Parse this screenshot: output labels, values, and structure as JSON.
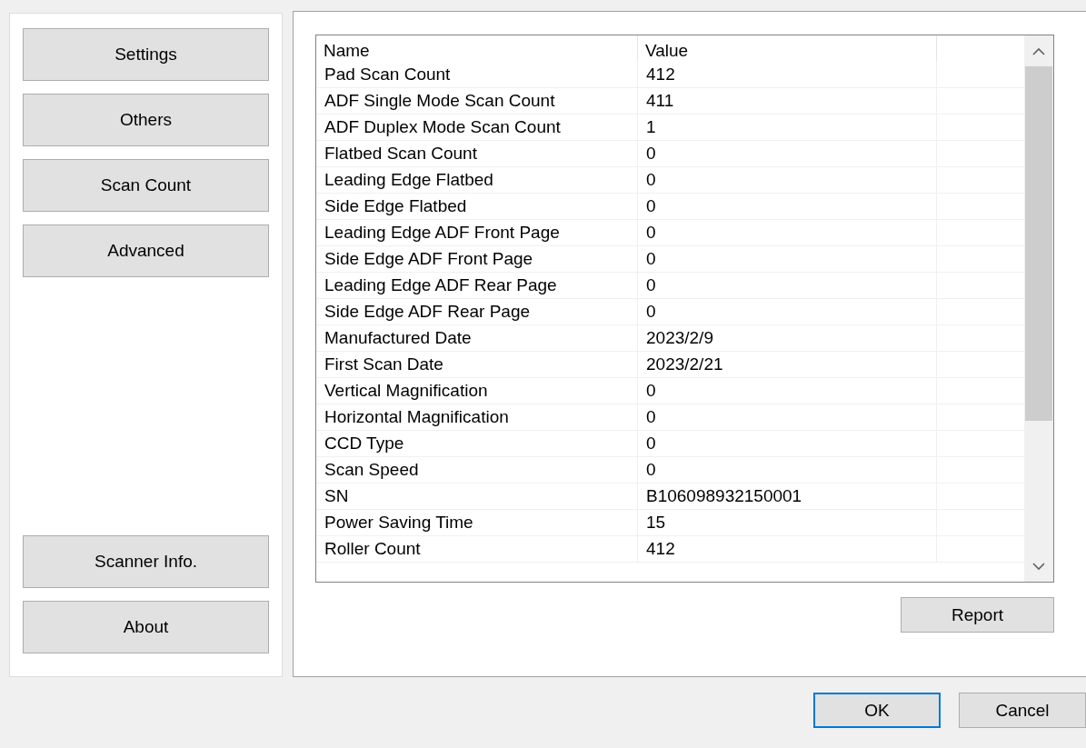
{
  "sidebar": {
    "top_buttons": [
      {
        "label": "Settings"
      },
      {
        "label": "Others"
      },
      {
        "label": "Scan Count"
      },
      {
        "label": "Advanced"
      }
    ],
    "bottom_buttons": [
      {
        "label": "Scanner Info."
      },
      {
        "label": "About"
      }
    ]
  },
  "table": {
    "columns": [
      "Name",
      "Value"
    ],
    "rows": [
      {
        "name": "Pad Scan Count",
        "value": "412"
      },
      {
        "name": "ADF Single Mode Scan Count",
        "value": "411"
      },
      {
        "name": "ADF Duplex Mode Scan Count",
        "value": "1"
      },
      {
        "name": "Flatbed Scan Count",
        "value": "0"
      },
      {
        "name": "Leading Edge Flatbed",
        "value": "0"
      },
      {
        "name": "Side Edge Flatbed",
        "value": "0"
      },
      {
        "name": "Leading Edge ADF Front Page",
        "value": "0"
      },
      {
        "name": "Side Edge ADF Front Page",
        "value": "0"
      },
      {
        "name": "Leading Edge ADF Rear Page",
        "value": "0"
      },
      {
        "name": "Side Edge ADF Rear Page",
        "value": "0"
      },
      {
        "name": "Manufactured Date",
        "value": "2023/2/9"
      },
      {
        "name": "First Scan Date",
        "value": "2023/2/21"
      },
      {
        "name": "Vertical Magnification",
        "value": "0"
      },
      {
        "name": "Horizontal Magnification",
        "value": "0"
      },
      {
        "name": "CCD Type",
        "value": "0"
      },
      {
        "name": "Scan Speed",
        "value": "0"
      },
      {
        "name": "SN",
        "value": "B106098932150001"
      },
      {
        "name": "Power Saving Time",
        "value": "15"
      },
      {
        "name": "Roller Count",
        "value": "412"
      }
    ]
  },
  "report_button": "Report",
  "dialog_buttons": [
    {
      "label": "OK",
      "kind": "default"
    },
    {
      "label": "Cancel",
      "kind": "normal"
    }
  ]
}
